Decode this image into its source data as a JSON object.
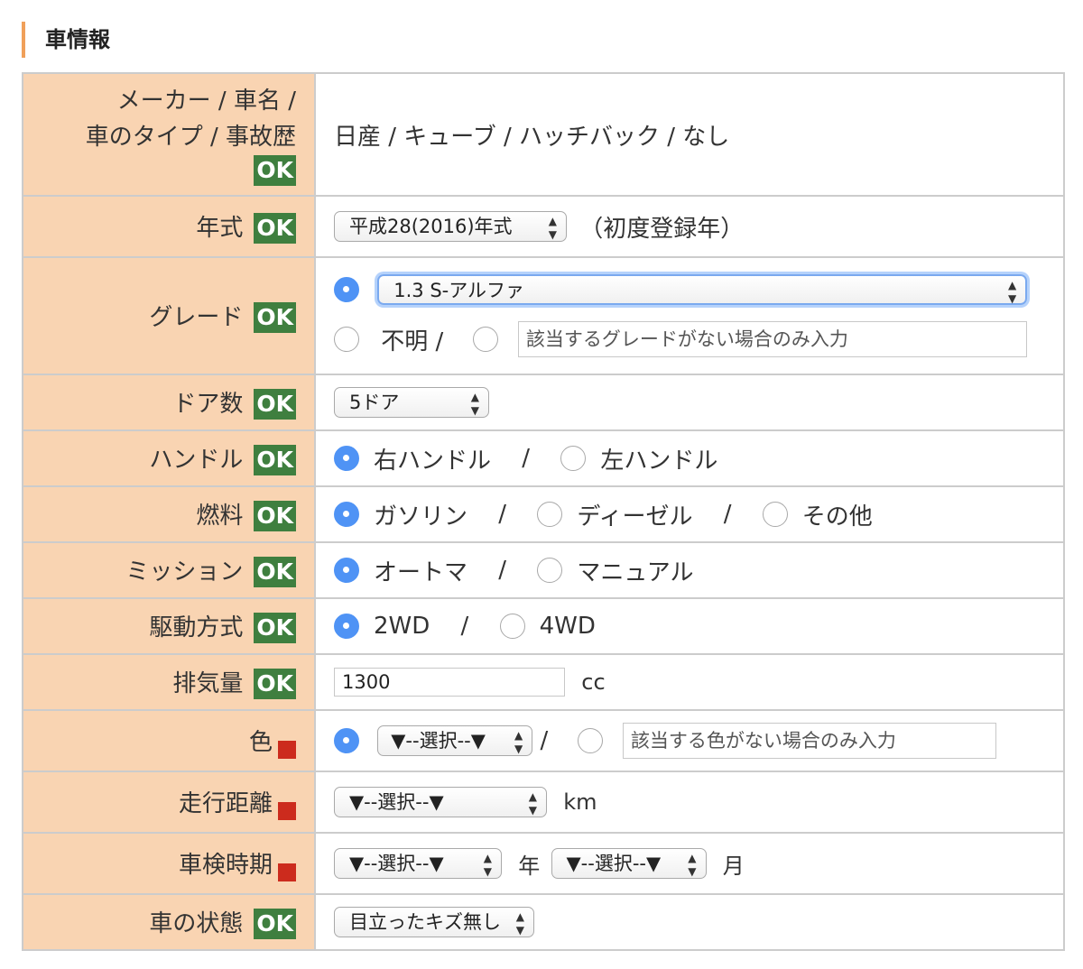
{
  "section": {
    "title": "車情報"
  },
  "ok_label": "OK",
  "rows": {
    "maker": {
      "label_line1": "メーカー / 車名 /",
      "label_line2": "車のタイプ / 事故歴",
      "value": "日産 / キューブ / ハッチバック / なし"
    },
    "year": {
      "label": "年式",
      "selected": "平成28(2016)年式",
      "note": "（初度登録年）"
    },
    "grade": {
      "label": "グレード",
      "selected": "1.3 S-アルファ",
      "unknown_label": "不明 /",
      "other_placeholder": "該当するグレードがない場合のみ入力"
    },
    "doors": {
      "label": "ドア数",
      "selected": "5ドア"
    },
    "handle": {
      "label": "ハンドル",
      "options": [
        "右ハンドル",
        "左ハンドル"
      ],
      "selected": "右ハンドル"
    },
    "fuel": {
      "label": "燃料",
      "options": [
        "ガソリン",
        "ディーゼル",
        "その他"
      ],
      "selected": "ガソリン"
    },
    "mission": {
      "label": "ミッション",
      "options": [
        "オートマ",
        "マニュアル"
      ],
      "selected": "オートマ"
    },
    "drive": {
      "label": "駆動方式",
      "options": [
        "2WD",
        "4WD"
      ],
      "selected": "2WD"
    },
    "displacement": {
      "label": "排気量",
      "value": "1300",
      "unit": "cc"
    },
    "color": {
      "label": "色",
      "selected": "▼--選択--▼",
      "other_placeholder": "該当する色がない場合のみ入力"
    },
    "mileage": {
      "label": "走行距離",
      "selected": "▼--選択--▼",
      "unit": "km"
    },
    "inspection": {
      "label": "車検時期",
      "year_selected": "▼--選択--▼",
      "year_unit": "年",
      "month_selected": "▼--選択--▼",
      "month_unit": "月"
    },
    "condition": {
      "label": "車の状態",
      "selected": "目立ったキズ無し"
    }
  },
  "separator": "/",
  "colors": {
    "header_bg": "#f9d4b2",
    "ok_badge": "#3f7f3f",
    "required_marker": "#cc2b1d",
    "radio_selected": "#4f93f5",
    "accent_bar": "#f0a05a"
  }
}
